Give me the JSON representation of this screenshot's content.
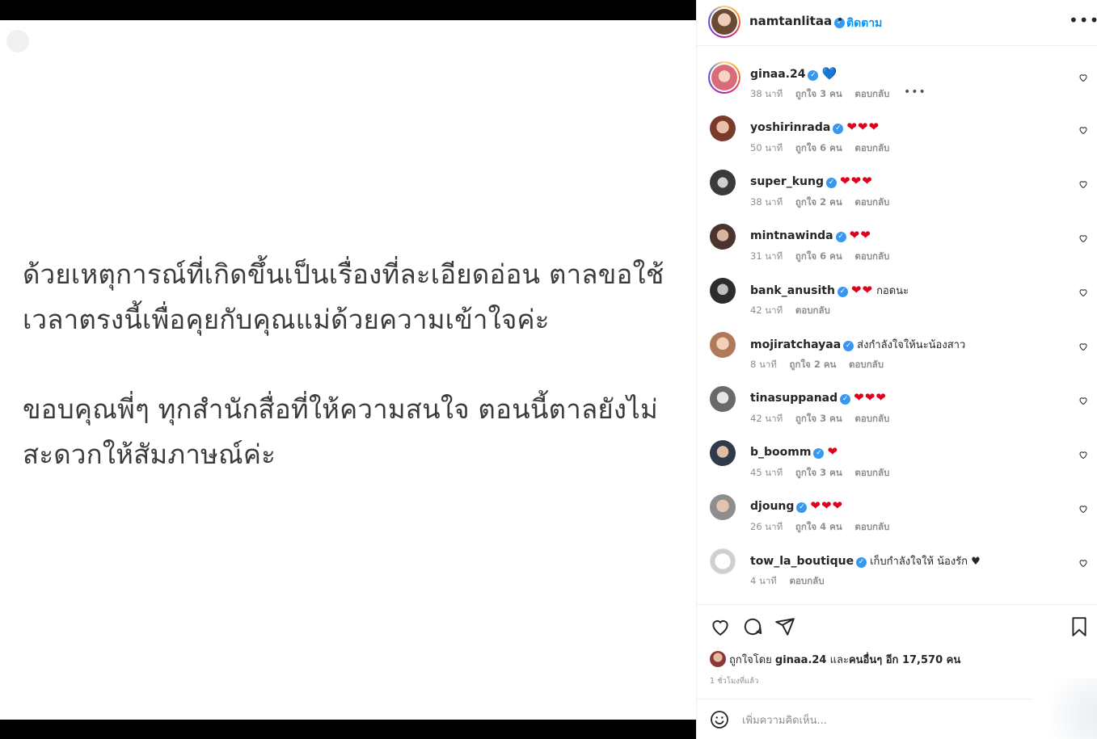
{
  "post": {
    "paragraphs": [
      "ด้วยเหตุการณ์ที่เกิดขึ้นเป็นเรื่องที่ละเอียดอ่อน ตาลขอใช้เวลาตรงนี้เพื่อคุยกับคุณแม่ด้วยความเข้าใจค่ะ",
      "ขอบคุณพี่ๆ ทุกสำนักสื่อที่ให้ความสนใจ ตอนนี้ตาลยังไม่สะดวกให้สัมภาษณ์ค่ะ"
    ]
  },
  "header": {
    "username": "namtanlitaa",
    "verified_icon": "verified-badge-icon",
    "separator": "•",
    "follow_label": "ติดตาม",
    "more_label": "•••"
  },
  "comments": [
    {
      "username": "ginaa.24",
      "emoji": "💙",
      "time": "38 นาที",
      "likes": "ถูกใจ 3 คน",
      "reply": "ตอบกลับ",
      "more": "•••"
    },
    {
      "username": "yoshirinrada",
      "emoji": "❤❤❤",
      "time": "50 นาที",
      "likes": "ถูกใจ 6 คน",
      "reply": "ตอบกลับ"
    },
    {
      "username": "super_kung",
      "emoji": "❤❤❤",
      "time": "38 นาที",
      "likes": "ถูกใจ 2 คน",
      "reply": "ตอบกลับ"
    },
    {
      "username": "mintnawinda",
      "emoji": "❤❤",
      "time": "31 นาที",
      "likes": "ถูกใจ 6 คน",
      "reply": "ตอบกลับ"
    },
    {
      "username": "bank_anusith",
      "emoji": "❤❤",
      "text": "กอดนะ",
      "time": "42 นาที",
      "reply": "ตอบกลับ"
    },
    {
      "username": "mojiratchayaa",
      "text": "ส่งกำลังใจให้นะน้องสาว",
      "time": "8 นาที",
      "likes": "ถูกใจ 2 คน",
      "reply": "ตอบกลับ"
    },
    {
      "username": "tinasuppanad",
      "emoji": "❤❤❤",
      "time": "42 นาที",
      "likes": "ถูกใจ 3 คน",
      "reply": "ตอบกลับ"
    },
    {
      "username": "b_boomm",
      "emoji": "❤",
      "time": "45 นาที",
      "likes": "ถูกใจ 3 คน",
      "reply": "ตอบกลับ"
    },
    {
      "username": "djoung",
      "emoji": "❤❤❤",
      "time": "26 นาที",
      "likes": "ถูกใจ 4 คน",
      "reply": "ตอบกลับ"
    },
    {
      "username": "tow_la_boutique",
      "text": "เก็บกำลังใจให้ น้องรัก ♥",
      "time": "4 นาที",
      "reply": "ตอบกลับ"
    }
  ],
  "likes_summary": {
    "prefix": "ถูกใจโดย",
    "user": "ginaa.24",
    "middle": "และ",
    "others": "คนอื่นๆ อีก 17,570 คน"
  },
  "time_ago": "1 ชั่วโมงที่แล้ว",
  "add_comment": {
    "placeholder": "เพิ่มความคิดเห็น..."
  },
  "icons": {
    "like": "heart-icon",
    "comment": "comment-icon",
    "share": "share-icon",
    "save": "bookmark-icon",
    "emoji": "emoji-icon"
  },
  "colors": {
    "link": "#0095f6",
    "verified": "#3897f0",
    "heart": "#e0001b"
  }
}
